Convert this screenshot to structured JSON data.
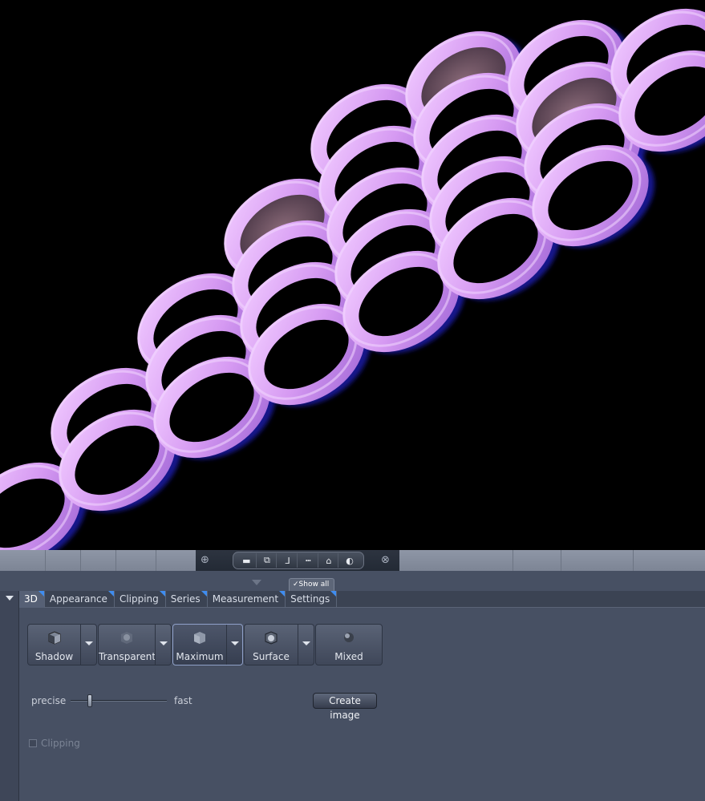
{
  "strip": {
    "show_all_label": "Show all",
    "show_all_check": "✓",
    "tools": [
      {
        "name": "ruler-horizontal-icon",
        "glyph": "▬"
      },
      {
        "name": "bounding-box-icon",
        "glyph": "⧉"
      },
      {
        "name": "axis-icon",
        "glyph": "⅃"
      },
      {
        "name": "scale-bar-icon",
        "glyph": "┅"
      },
      {
        "name": "home-icon",
        "glyph": "⌂"
      },
      {
        "name": "light-sphere-icon",
        "glyph": "◐"
      }
    ],
    "left_icon": "⊕",
    "right_icon": "⊗"
  },
  "tabs": [
    {
      "label": "3D",
      "active": true
    },
    {
      "label": "Appearance",
      "active": false
    },
    {
      "label": "Clipping",
      "active": false
    },
    {
      "label": "Series",
      "active": false
    },
    {
      "label": "Measurement",
      "active": false
    },
    {
      "label": "Settings",
      "active": false
    }
  ],
  "render_modes": [
    {
      "label": "Shadow",
      "icon": "cube-shadow-icon",
      "has_dropdown": true,
      "active": false
    },
    {
      "label": "Transparent",
      "icon": "cube-transparent-icon",
      "has_dropdown": true,
      "active": false
    },
    {
      "label": "Maximum",
      "icon": "cube-maximum-icon",
      "has_dropdown": true,
      "active": true
    },
    {
      "label": "Surface",
      "icon": "cube-surface-icon",
      "has_dropdown": true,
      "active": false
    },
    {
      "label": "Mixed",
      "icon": "sphere-mixed-icon",
      "has_dropdown": false,
      "active": false
    }
  ],
  "quality": {
    "min_label": "precise",
    "max_label": "fast",
    "value": 0.2
  },
  "create_image_label": "Create image",
  "clipping": {
    "label": "Clipping",
    "checked": false
  },
  "colors": {
    "mesh": "#d99bf3",
    "mesh_highlight": "#f3d7ff",
    "mesh_shadow": "#6a3fb0",
    "glow": "#2a2cff",
    "panel": "#475063",
    "tab_marker": "#3f8df0"
  }
}
